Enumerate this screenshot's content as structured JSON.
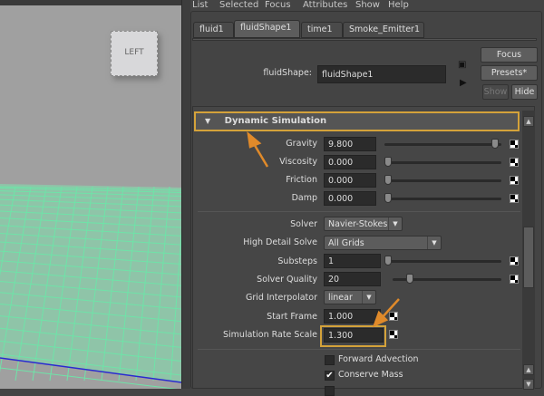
{
  "viewport": {
    "view_cube_label": "LEFT"
  },
  "menu": [
    "List",
    "Selected",
    "Focus",
    "Attributes",
    "Show",
    "Help"
  ],
  "tabs": [
    {
      "label": "fluid1"
    },
    {
      "label": "fluidShape1",
      "active": true
    },
    {
      "label": "time1"
    },
    {
      "label": "Smoke_Emitter1"
    }
  ],
  "node": {
    "label": "fluidShape:",
    "value": "fluidShape1"
  },
  "buttons": {
    "focus": "Focus",
    "presets": "Presets*",
    "show": "Show",
    "hide": "Hide"
  },
  "section": {
    "title": "Dynamic Simulation"
  },
  "sliders": [
    {
      "label": "Gravity",
      "value": "9.800",
      "fraction": 0.94
    },
    {
      "label": "Viscosity",
      "value": "0.000",
      "fraction": 0.0
    },
    {
      "label": "Friction",
      "value": "0.000",
      "fraction": 0.0
    },
    {
      "label": "Damp",
      "value": "0.000",
      "fraction": 0.0
    }
  ],
  "solver": {
    "label": "Solver",
    "value": "Navier-Stokes"
  },
  "high_detail": {
    "label": "High Detail Solve",
    "value": "All Grids"
  },
  "substeps": {
    "label": "Substeps",
    "value": "1",
    "fraction": 0.0
  },
  "solver_quality": {
    "label": "Solver Quality",
    "value": "20",
    "fraction": 0.2
  },
  "grid_interp": {
    "label": "Grid Interpolator",
    "value": "linear"
  },
  "start_frame": {
    "label": "Start Frame",
    "value": "1.000"
  },
  "sim_rate": {
    "label": "Simulation Rate Scale",
    "value": "1.300"
  },
  "checkboxes": [
    {
      "label": "Forward Advection",
      "checked": false
    },
    {
      "label": "Conserve Mass",
      "checked": true
    }
  ],
  "colors": {
    "highlight": "#d4a23a",
    "grid": "#6fe3a8",
    "viewport": "#a0a0a0"
  }
}
